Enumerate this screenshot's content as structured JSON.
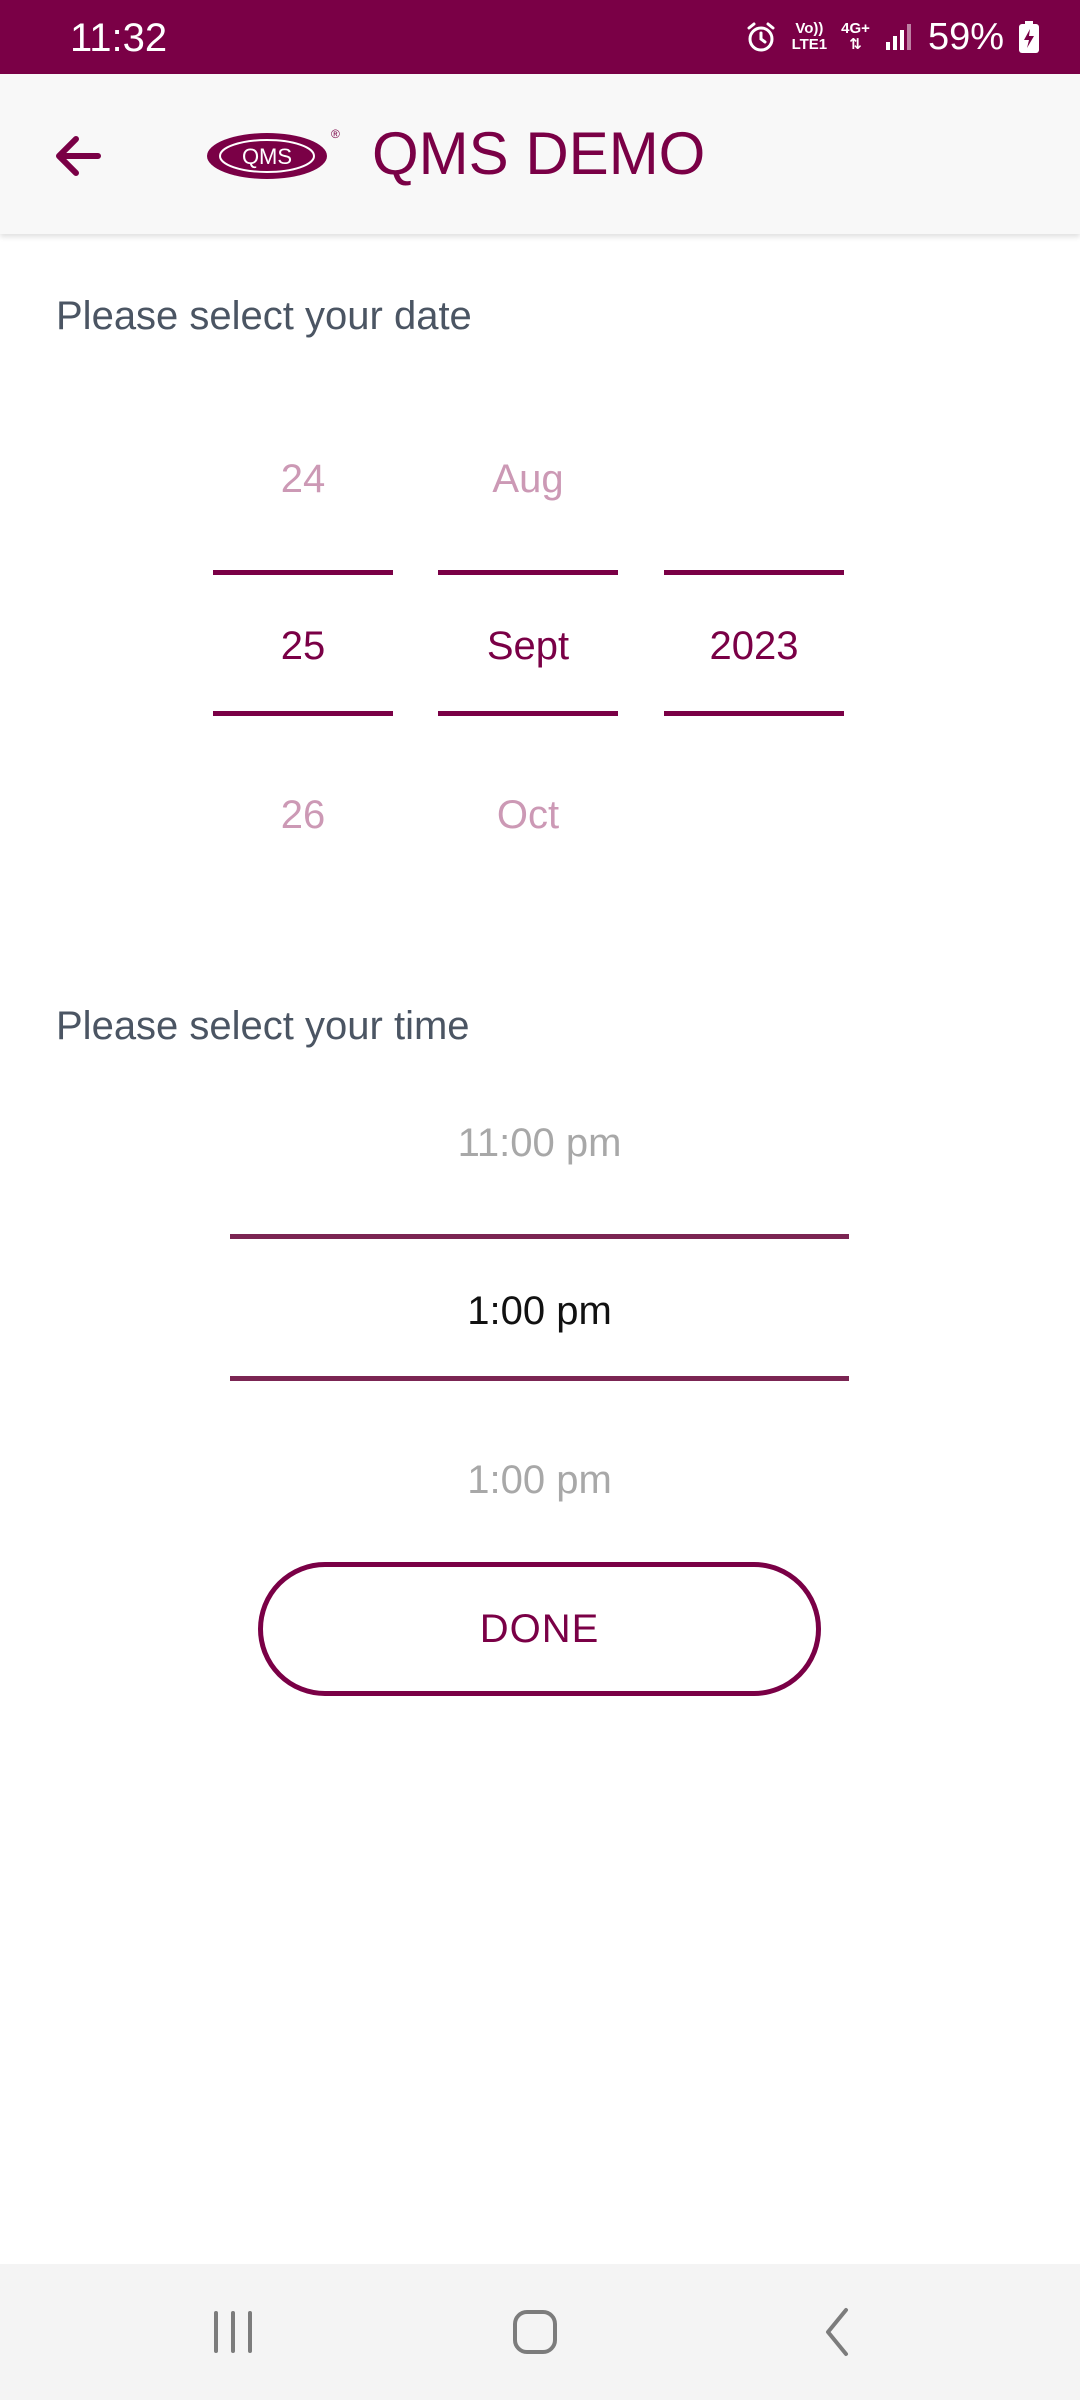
{
  "status_bar": {
    "time": "11:32",
    "network_top": "Vo))",
    "network_bottom": "LTE1",
    "network_type": "4G+",
    "battery": "59%"
  },
  "app_bar": {
    "logo_text": "QMS",
    "title": "QMS DEMO"
  },
  "date_section": {
    "label": "Please select your date",
    "day": {
      "prev": "24",
      "selected": "25",
      "next": "26"
    },
    "month": {
      "prev": "Aug",
      "selected": "Sept",
      "next": "Oct"
    },
    "year": {
      "prev": "",
      "selected": "2023",
      "next": ""
    }
  },
  "time_section": {
    "label": "Please select your time",
    "prev": "11:00 pm",
    "selected": "1:00 pm",
    "next": "1:00 pm"
  },
  "done_label": "DONE",
  "colors": {
    "brand": "#7a0046",
    "faded_brand": "#cc99b5",
    "label_gray": "#4b5563"
  },
  "icons": {
    "back": "arrow-left-icon",
    "recents": "recents-icon",
    "home": "home-icon",
    "nav_back": "chevron-left-icon"
  }
}
